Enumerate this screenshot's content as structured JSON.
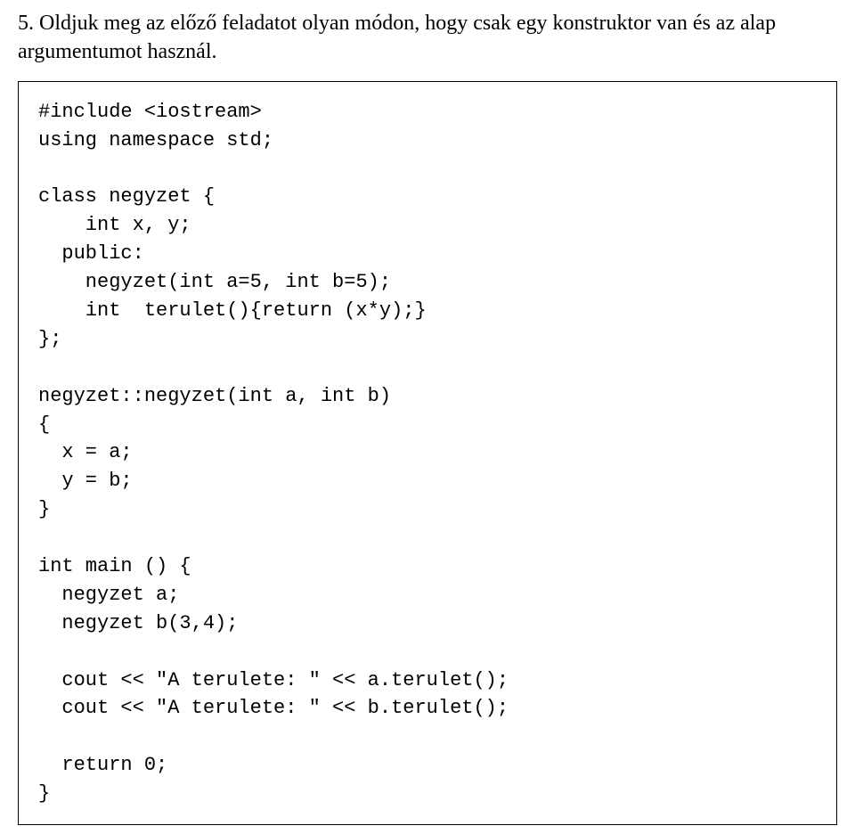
{
  "intro": "5. Oldjuk meg az előző feladatot olyan módon, hogy csak egy konstruktor van és az alap argumentumot használ.",
  "code": "#include <iostream>\nusing namespace std;\n\nclass negyzet {\n    int x, y;\n  public:\n    negyzet(int a=5, int b=5);\n    int  terulet(){return (x*y);}\n};\n\nnegyzet::negyzet(int a, int b)\n{\n  x = a;\n  y = b;\n}\n\nint main () {\n  negyzet a;\n  negyzet b(3,4);\n\n  cout << \"A terulete: \" << a.terulet();\n  cout << \"A terulete: \" << b.terulet();\n\n  return 0;\n}"
}
